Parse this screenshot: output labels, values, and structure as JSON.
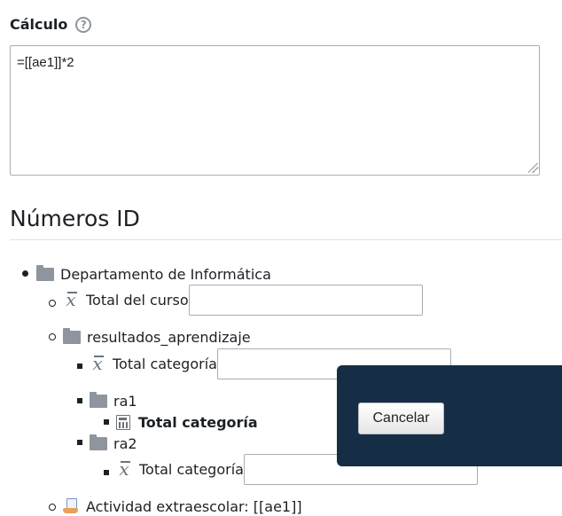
{
  "calculation": {
    "label": "Cálculo",
    "help_icon_glyph": "?",
    "value": "=[[ae1]]*2"
  },
  "id_numbers": {
    "title": "Números ID",
    "tree": {
      "department": {
        "label": "Departamento de Informática",
        "icon": "folder-icon"
      },
      "course_total": {
        "label": "Total del curso",
        "icon": "mean-icon",
        "input_value": ""
      },
      "learning_outcomes": {
        "label": "resultados_aprendizaje",
        "icon": "folder-icon"
      },
      "outcomes_total": {
        "label": "Total categoría",
        "icon": "mean-icon",
        "input_value": ""
      },
      "ra1": {
        "label": "ra1",
        "icon": "folder-icon"
      },
      "ra1_total": {
        "label": "Total categoría",
        "icon": "calculator-icon"
      },
      "ra2": {
        "label": "ra2",
        "icon": "folder-icon"
      },
      "ra2_total": {
        "label": "Total categoría",
        "icon": "mean-icon",
        "input_value": ""
      },
      "activity": {
        "label": "Actividad extraescolar: [[ae1]]",
        "icon": "activity-icon"
      }
    }
  },
  "dialog": {
    "cancel_label": "Cancelar",
    "background_color": "#152e45"
  },
  "icons": {
    "mean_glyph": "x"
  }
}
